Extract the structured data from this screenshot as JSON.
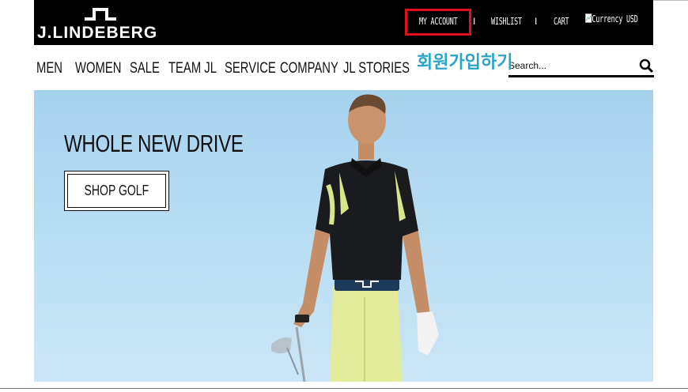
{
  "brand": {
    "logo_text": "J.LINDEBERG"
  },
  "utility_nav": {
    "my_account": "MY ACCOUNT",
    "wishlist": "WISHLIST",
    "cart": "CART",
    "separator": "I",
    "currency_alt": "Currency",
    "currency_value": "USD"
  },
  "main_nav": [
    "MEN",
    "WOMEN",
    "SALE",
    "TEAM JL",
    "SERVICE",
    "COMPANY",
    "JL STORIES"
  ],
  "overlay_text": "회원가입하기",
  "search": {
    "placeholder": "Search..."
  },
  "hero": {
    "title": "WHOLE NEW DRIVE",
    "cta_label": "SHOP GOLF"
  },
  "colors": {
    "topbar": "#000000",
    "highlight_box": "#e0111b",
    "overlay_text": "#2aa5c8",
    "sky": "#b7dcf2"
  }
}
